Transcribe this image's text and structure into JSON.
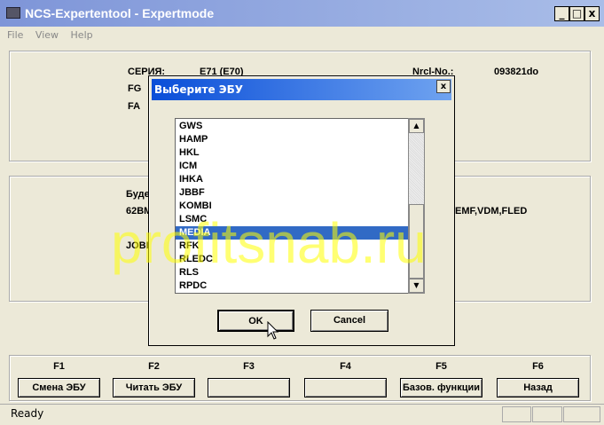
{
  "window": {
    "title": "NCS-Expertentool - Expertmode",
    "min": "_",
    "max": "□",
    "close": "x"
  },
  "menu": [
    "File",
    "View",
    "Help"
  ],
  "info": {
    "series_label": "СЕРИЯ:",
    "series_value": "E71 (E70)",
    "fg_label": "FG",
    "fa_label": "FA",
    "nrcl_label": "Nrcl-No.:",
    "nrcl_value": "093821do"
  },
  "panel2": {
    "line1": "Буде",
    "line2_left": "62BM",
    "line2_right": "EMF,VDM,FLED",
    "line3": "JOBI"
  },
  "dialog": {
    "title": "Выберите ЭБУ",
    "close": "x",
    "items": [
      "GWS",
      "HAMP",
      "HKL",
      "ICM",
      "IHKA",
      "JBBF",
      "KOMBI",
      "LSMC",
      "MEDIA",
      "RFK",
      "RLEDC",
      "RLS",
      "RPDC"
    ],
    "selected": "MEDIA",
    "ok": "OK",
    "cancel": "Cancel"
  },
  "fkeys": [
    {
      "key": "F1",
      "label": "Смена ЭБУ"
    },
    {
      "key": "F2",
      "label": "Читать ЭБУ"
    },
    {
      "key": "F3",
      "label": ""
    },
    {
      "key": "F4",
      "label": ""
    },
    {
      "key": "F5",
      "label": "Базов. функции"
    },
    {
      "key": "F6",
      "label": "Назад"
    }
  ],
  "status": "Ready",
  "watermark": "profitsnab.ru"
}
